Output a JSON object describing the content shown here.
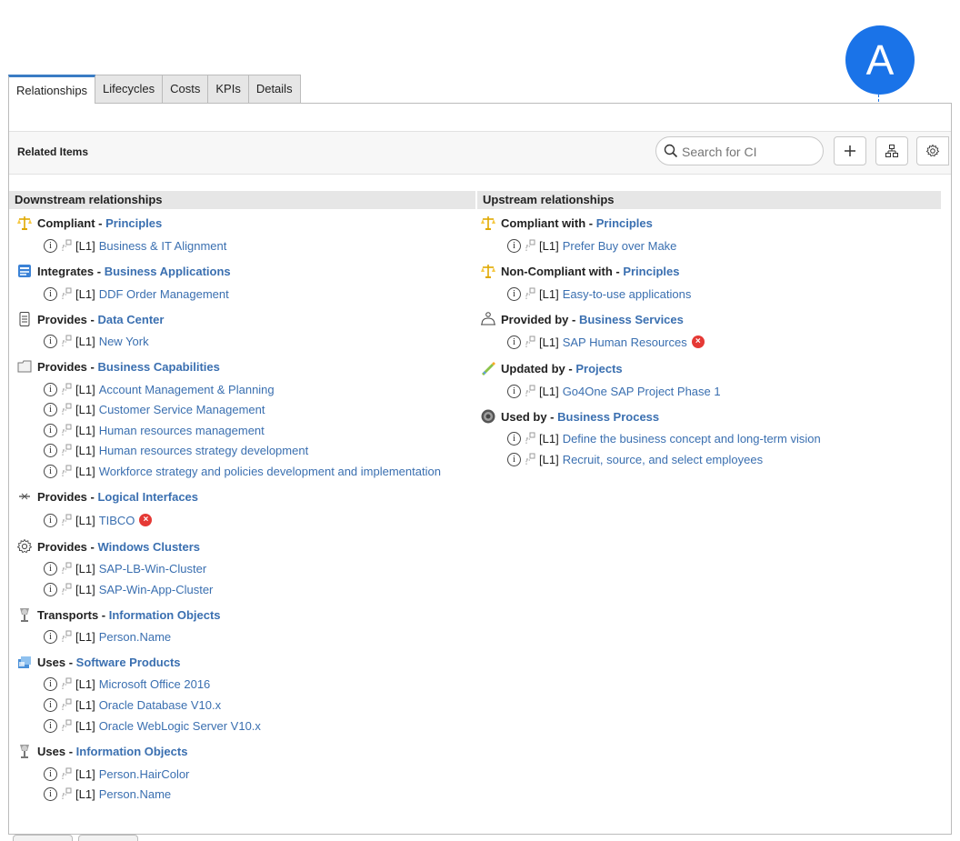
{
  "tabs": [
    "Relationships",
    "Lifecycles",
    "Costs",
    "KPIs",
    "Details"
  ],
  "toolbar": {
    "title": "Related Items",
    "search_placeholder": "Search for CI"
  },
  "callout": "A",
  "level": "[L1]",
  "downstream": {
    "title": "Downstream relationships",
    "groups": [
      {
        "verb": "Compliant - ",
        "target": "Principles",
        "icon": "scales-icon",
        "items": [
          {
            "text": "Business & IT Alignment"
          }
        ]
      },
      {
        "verb": "Integrates - ",
        "target": "Business Applications",
        "icon": "application-icon",
        "items": [
          {
            "text": "DDF Order Management"
          }
        ]
      },
      {
        "verb": "Provides - ",
        "target": "Data Center",
        "icon": "server-icon",
        "items": [
          {
            "text": "New York"
          }
        ]
      },
      {
        "verb": "Provides - ",
        "target": "Business Capabilities",
        "icon": "folder-icon",
        "items": [
          {
            "text": "Account Management & Planning"
          },
          {
            "text": "Customer Service Management"
          },
          {
            "text": "Human resources management"
          },
          {
            "text": "Human resources strategy development"
          },
          {
            "text": "Workforce strategy and policies development and implementation"
          }
        ]
      },
      {
        "verb": "Provides - ",
        "target": "Logical Interfaces",
        "icon": "interface-icon",
        "items": [
          {
            "text": "TIBCO",
            "error": true
          }
        ]
      },
      {
        "verb": "Provides - ",
        "target": "Windows Clusters",
        "icon": "cluster-gear-icon",
        "items": [
          {
            "text": "SAP-LB-Win-Cluster"
          },
          {
            "text": "SAP-Win-App-Cluster"
          }
        ]
      },
      {
        "verb": "Transports - ",
        "target": "Information Objects",
        "icon": "info-object-icon",
        "items": [
          {
            "text": "Person.Name"
          }
        ]
      },
      {
        "verb": "Uses - ",
        "target": "Software Products",
        "icon": "software-icon",
        "items": [
          {
            "text": "Microsoft Office 2016"
          },
          {
            "text": "Oracle Database V10.x"
          },
          {
            "text": "Oracle WebLogic Server V10.x"
          }
        ]
      },
      {
        "verb": "Uses - ",
        "target": "Information Objects",
        "icon": "info-object-icon",
        "items": [
          {
            "text": "Person.HairColor"
          },
          {
            "text": "Person.Name"
          }
        ]
      }
    ]
  },
  "upstream": {
    "title": "Upstream relationships",
    "groups": [
      {
        "verb": "Compliant with - ",
        "target": "Principles",
        "icon": "scales-icon",
        "items": [
          {
            "text": "Prefer Buy over Make"
          }
        ]
      },
      {
        "verb": "Non-Compliant with - ",
        "target": "Principles",
        "icon": "scales-icon",
        "items": [
          {
            "text": "Easy-to-use applications"
          }
        ]
      },
      {
        "verb": "Provided by - ",
        "target": "Business Services",
        "icon": "service-icon",
        "items": [
          {
            "text": "SAP Human Resources",
            "error": true
          }
        ]
      },
      {
        "verb": "Updated by - ",
        "target": "Projects",
        "icon": "project-icon",
        "items": [
          {
            "text": "Go4One SAP Project Phase 1"
          }
        ]
      },
      {
        "verb": "Used by - ",
        "target": "Business Process",
        "icon": "process-icon",
        "items": [
          {
            "text": "Define the business concept and long-term vision"
          },
          {
            "text": "Recruit, source, and select employees"
          }
        ]
      }
    ]
  }
}
